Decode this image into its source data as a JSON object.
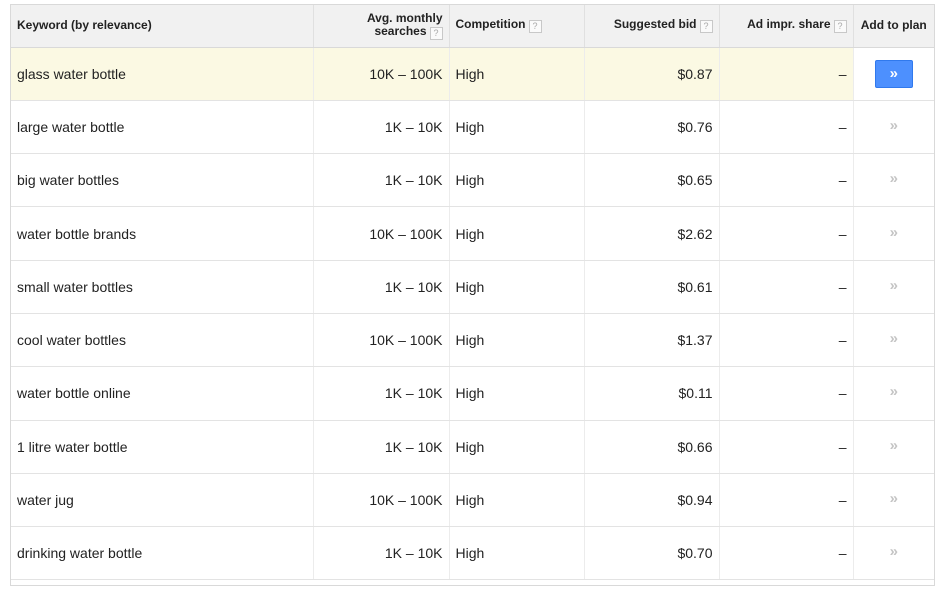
{
  "columns": {
    "keyword": "Keyword (by relevance)",
    "avg_line1": "Avg. monthly",
    "avg_line2": "searches",
    "competition": "Competition",
    "bid": "Suggested bid",
    "ad_share": "Ad impr. share",
    "add": "Add to plan",
    "help_glyph": "?"
  },
  "add_glyph": "»",
  "rows": [
    {
      "keyword": "glass water bottle",
      "searches": "10K – 100K",
      "competition": "High",
      "bid": "$0.87",
      "ad_share": "–"
    },
    {
      "keyword": "large water bottle",
      "searches": "1K – 10K",
      "competition": "High",
      "bid": "$0.76",
      "ad_share": "–"
    },
    {
      "keyword": "big water bottles",
      "searches": "1K – 10K",
      "competition": "High",
      "bid": "$0.65",
      "ad_share": "–"
    },
    {
      "keyword": "water bottle brands",
      "searches": "10K – 100K",
      "competition": "High",
      "bid": "$2.62",
      "ad_share": "–"
    },
    {
      "keyword": "small water bottles",
      "searches": "1K – 10K",
      "competition": "High",
      "bid": "$0.61",
      "ad_share": "–"
    },
    {
      "keyword": "cool water bottles",
      "searches": "10K – 100K",
      "competition": "High",
      "bid": "$1.37",
      "ad_share": "–"
    },
    {
      "keyword": "water bottle online",
      "searches": "1K – 10K",
      "competition": "High",
      "bid": "$0.11",
      "ad_share": "–"
    },
    {
      "keyword": "1 litre water bottle",
      "searches": "1K – 10K",
      "competition": "High",
      "bid": "$0.66",
      "ad_share": "–"
    },
    {
      "keyword": "water jug",
      "searches": "10K – 100K",
      "competition": "High",
      "bid": "$0.94",
      "ad_share": "–"
    },
    {
      "keyword": "drinking water bottle",
      "searches": "1K – 10K",
      "competition": "High",
      "bid": "$0.70",
      "ad_share": "–"
    }
  ],
  "colors": {
    "highlight_row": "#fbf9e3",
    "active_button": "#4d90fe"
  }
}
